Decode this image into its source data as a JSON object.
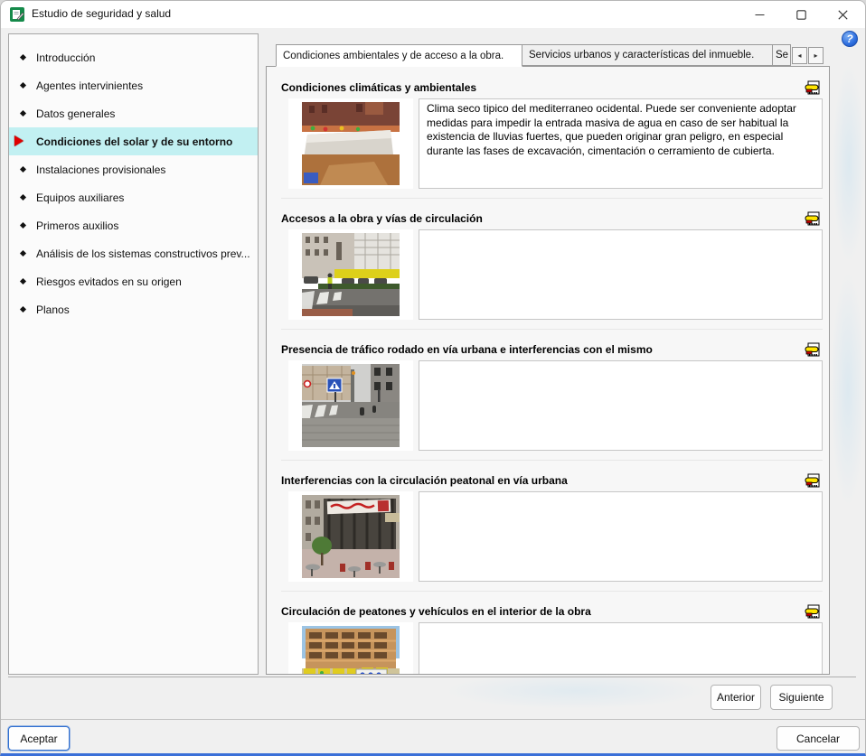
{
  "window": {
    "title": "Estudio de seguridad y salud",
    "help_glyph": "?"
  },
  "sidebar": {
    "items": [
      {
        "label": "Introducción",
        "selected": false
      },
      {
        "label": "Agentes intervinientes",
        "selected": false
      },
      {
        "label": "Datos generales",
        "selected": false
      },
      {
        "label": "Condiciones del solar y de su entorno",
        "selected": true
      },
      {
        "label": "Instalaciones provisionales",
        "selected": false
      },
      {
        "label": "Equipos auxiliares",
        "selected": false
      },
      {
        "label": "Primeros auxilios",
        "selected": false
      },
      {
        "label": "Análisis de los sistemas constructivos prev...",
        "selected": false
      },
      {
        "label": "Riesgos evitados en su origen",
        "selected": false
      },
      {
        "label": "Planos",
        "selected": false
      }
    ]
  },
  "tabs": {
    "active": "Condiciones ambientales y de acceso a la obra.",
    "inactive": "Servicios urbanos y características del inmueble.",
    "truncated": "Se",
    "scroll_left": "◂",
    "scroll_right": "▸"
  },
  "sections": [
    {
      "title": "Condiciones climáticas y ambientales",
      "text": "Clima seco tipico del mediterraneo ocidental. Puede ser conveniente adoptar medidas para impedir la entrada masiva de agua en caso de ser habitual la existencia de lluvias fuertes, que pueden originar gran peligro, en especial durante las fases de excavación, cimentación o cerramiento de cubierta.",
      "photo_alt": "excavation-covered-with-tarp"
    },
    {
      "title": "Accesos a la obra y vías de circulación",
      "text": "",
      "photo_alt": "street-access-with-crosswalk"
    },
    {
      "title": "Presencia de tráfico rodado en vía urbana e interferencias con el mismo",
      "text": "",
      "photo_alt": "urban-street-with-crosswalk-sign"
    },
    {
      "title": "Interferencias con la circulación peatonal en vía urbana",
      "text": "",
      "photo_alt": "scaffolding-with-banner-over-sidewalk-cafe"
    },
    {
      "title": "Circulación de peatones y vehículos en el interior de la obra",
      "text": "",
      "photo_alt": "construction-site-interior-with-signboard"
    }
  ],
  "footer": {
    "anterior": "Anterior",
    "siguiente": "Siguiente",
    "aceptar": "Aceptar",
    "cancelar": "Cancelar"
  },
  "colors": {
    "accent_blue": "#2e6fe0",
    "selected_cyan": "#c2f0f2",
    "marker_yellow": "#ffe400",
    "marker_red": "#d40000",
    "title_icon_green": "#158a4a",
    "bottom_border_blue": "#3a6fd8"
  }
}
